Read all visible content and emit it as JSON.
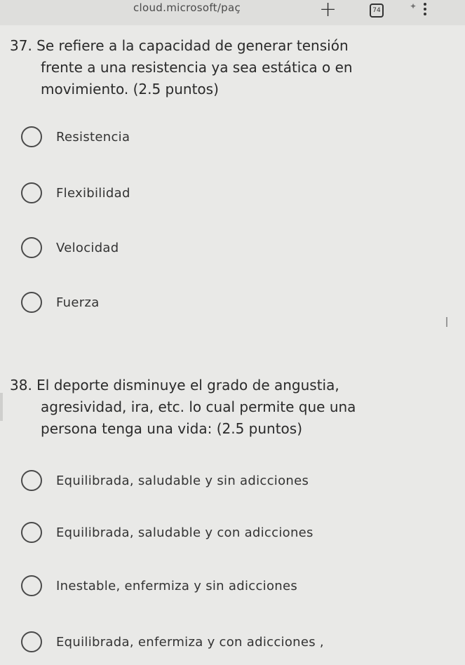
{
  "browser": {
    "url_fragment": "cloud.microsoft/paç",
    "new_tab_symbol": "+",
    "tab_count": "74",
    "menu_icon": "three-dots-vertical-icon"
  },
  "questions": [
    {
      "number": "37.",
      "line1": "Se refiere a la capacidad de generar tensión",
      "line2": "frente a una resistencia ya sea estática o en",
      "line3": "movimiento. (2.5 puntos)",
      "options": [
        "Resistencia",
        "Flexibilidad",
        "Velocidad",
        "Fuerza"
      ]
    },
    {
      "number": "38.",
      "line1": "El deporte disminuye el grado de angustia,",
      "line2": "agresividad, ira, etc. lo cual permite que una",
      "line3": "persona tenga una vida: (2.5 puntos)",
      "options": [
        "Equilibrada, saludable y sin adicciones",
        "Equilibrada, saludable y con adicciones",
        "Inestable, enfermiza y sin adicciones",
        "Equilibrada, enfermiza y con adicciones ,"
      ]
    }
  ]
}
